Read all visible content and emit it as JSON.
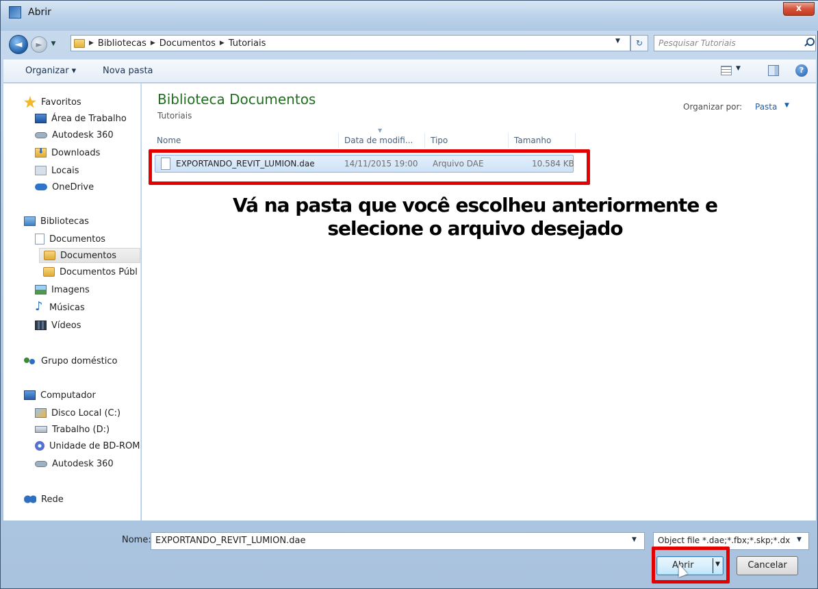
{
  "window": {
    "title": "Abrir",
    "close_label": "x"
  },
  "address_bar": {
    "breadcrumbs": [
      "Bibliotecas",
      "Documentos",
      "Tutoriais"
    ],
    "search_placeholder": "Pesquisar Tutoriais"
  },
  "toolbar": {
    "organize_label": "Organizar ▾",
    "new_folder_label": "Nova pasta"
  },
  "nav_pane": {
    "favorites": {
      "header": "Favoritos",
      "items": [
        "Área de Trabalho",
        "Autodesk 360",
        "Downloads",
        "Locais",
        "OneDrive"
      ]
    },
    "libraries": {
      "header": "Bibliotecas",
      "documents": "Documentos",
      "documents_sub": [
        "Documentos",
        "Documentos Públ"
      ],
      "items": [
        "Imagens",
        "Músicas",
        "Vídeos"
      ]
    },
    "homegroup": "Grupo doméstico",
    "computer": {
      "header": "Computador",
      "items": [
        "Disco Local (C:)",
        "Trabalho (D:)",
        "Unidade de BD-ROM",
        "Autodesk 360"
      ]
    },
    "network": "Rede"
  },
  "content": {
    "library_title": "Biblioteca Documentos",
    "library_subtitle": "Tutoriais",
    "arrange_by_label": "Organizar por:",
    "arrange_by_value": "Pasta",
    "columns": [
      "Nome",
      "Data de modifi...",
      "Tipo",
      "Tamanho"
    ],
    "files": [
      {
        "name": "EXPORTANDO_REVIT_LUMION.dae",
        "date": "14/11/2015 19:00",
        "type": "Arquivo DAE",
        "size": "10.584 KB"
      }
    ]
  },
  "annotation": {
    "line1": "Vá na pasta que você escolheu anteriormente e",
    "line2": "selecione o arquivo desejado"
  },
  "footer": {
    "name_label": "Nome:",
    "name_value": "EXPORTANDO_REVIT_LUMION.dae",
    "file_type": "Object file *.dae;*.fbx;*.skp;*.dx",
    "open_label": "Abrir",
    "cancel_label": "Cancelar"
  },
  "colors": {
    "highlight": "#e30000",
    "library_title": "#1e6e1e",
    "link": "#1a5fb0"
  }
}
